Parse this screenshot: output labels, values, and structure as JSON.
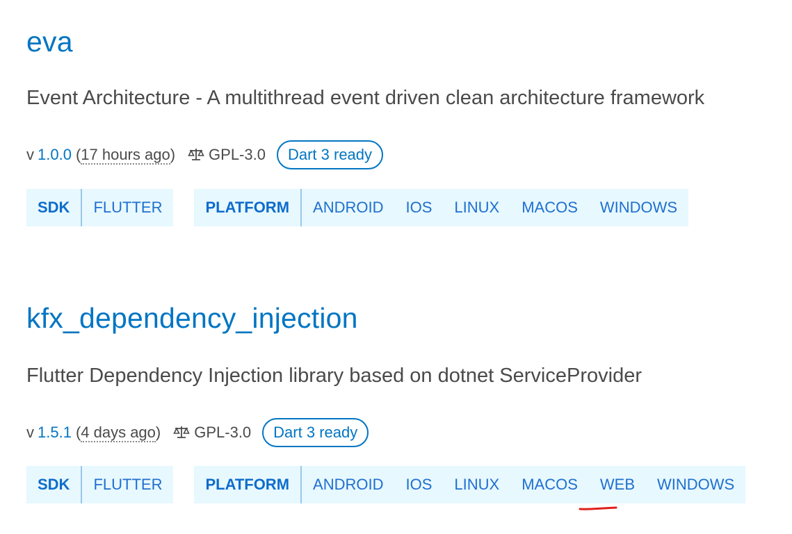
{
  "packages": [
    {
      "name": "eva",
      "description": "Event Architecture - A multithread event driven clean architecture framework",
      "version_prefix": "v",
      "version": "1.0.0",
      "published_open": "(",
      "published": "17 hours ago",
      "published_close": ")",
      "license": "GPL-3.0",
      "badge": "Dart 3 ready",
      "sdk": {
        "label": "SDK",
        "items": [
          "FLUTTER"
        ]
      },
      "platform": {
        "label": "PLATFORM",
        "items": [
          "ANDROID",
          "IOS",
          "LINUX",
          "MACOS",
          "WINDOWS"
        ]
      }
    },
    {
      "name": "kfx_dependency_injection",
      "description": "Flutter Dependency Injection library based on dotnet ServiceProvider",
      "version_prefix": "v",
      "version": "1.5.1",
      "published_open": "(",
      "published": "4 days ago",
      "published_close": ")",
      "license": "GPL-3.0",
      "badge": "Dart 3 ready",
      "sdk": {
        "label": "SDK",
        "items": [
          "FLUTTER"
        ]
      },
      "platform": {
        "label": "PLATFORM",
        "items": [
          "ANDROID",
          "IOS",
          "LINUX",
          "MACOS",
          "WEB",
          "WINDOWS"
        ]
      }
    }
  ],
  "annotation": {
    "color": "#e0201b"
  },
  "colors": {
    "link": "#0175c2",
    "tag_bg": "#e7f8ff",
    "text": "#4a4a4a"
  }
}
